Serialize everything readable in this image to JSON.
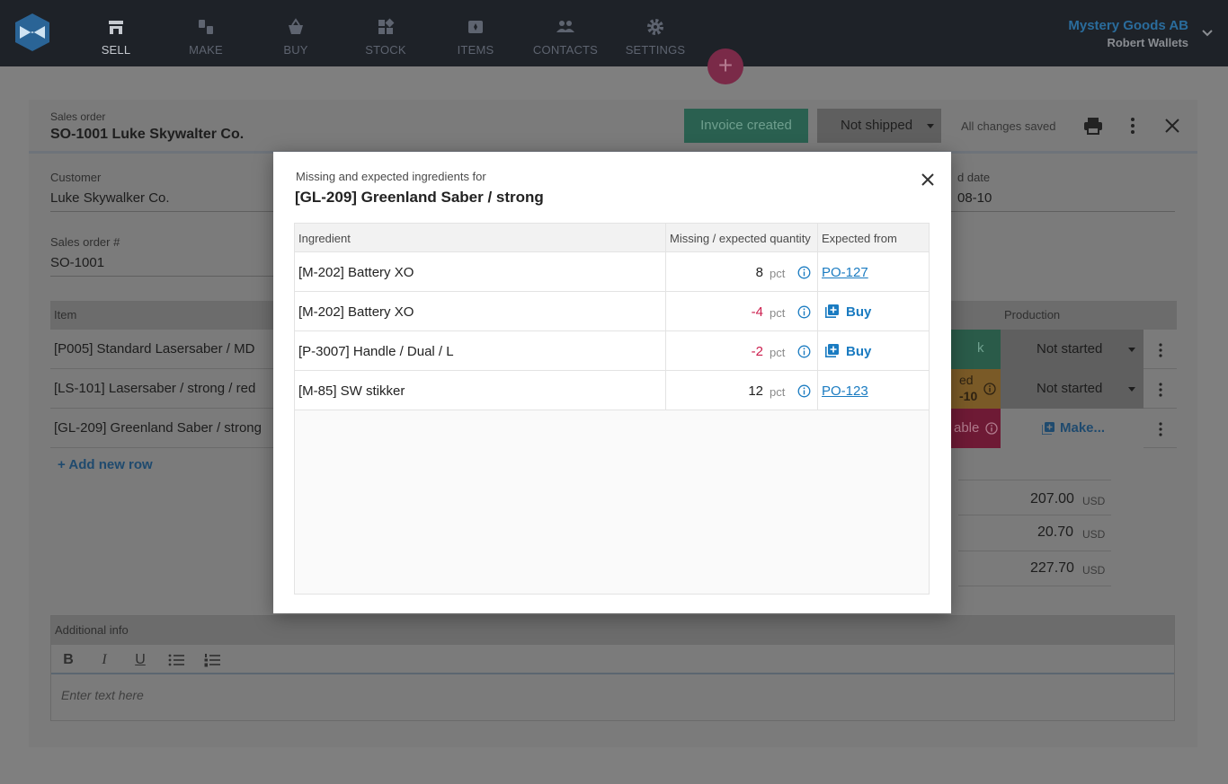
{
  "nav": {
    "items": [
      {
        "label": "SELL",
        "icon": "shop-icon",
        "active": true
      },
      {
        "label": "MAKE",
        "icon": "thumbs-icon"
      },
      {
        "label": "BUY",
        "icon": "basket-icon"
      },
      {
        "label": "STOCK",
        "icon": "stock-icon"
      },
      {
        "label": "ITEMS",
        "icon": "items-icon"
      },
      {
        "label": "CONTACTS",
        "icon": "contacts-icon"
      },
      {
        "label": "SETTINGS",
        "icon": "gear-icon"
      }
    ],
    "company": "Mystery Goods AB",
    "user": "Robert Wallets",
    "fab_label": "+"
  },
  "order": {
    "label": "Sales order",
    "title": "SO-1001  Luke Skywalter Co.",
    "invoice_status": "Invoice created",
    "shipping_status": "Not shipped",
    "save_status": "All changes saved",
    "customer_label": "Customer",
    "customer": "Luke Skywalker Co.",
    "order_no_label": "Sales order #",
    "order_no": "SO-1001",
    "delivery_label": "d date",
    "delivery_value": "08-10",
    "columns": {
      "item": "Item",
      "production": "Production"
    },
    "rows": [
      {
        "item": "[P005] Standard Lasersaber / MD",
        "status_text": "k",
        "production": "Not started"
      },
      {
        "item": "[LS-101] Lasersaber / strong / red",
        "status_text": "ed",
        "status_sub": "-10",
        "production": "Not started"
      },
      {
        "item": "[GL-209] Greenland Saber / strong",
        "status_text": "able",
        "production": "Make..."
      }
    ],
    "add_row": "+ Add new row",
    "totals": [
      {
        "value": "207.00",
        "currency": "USD"
      },
      {
        "value": "20.70",
        "currency": "USD"
      },
      {
        "value": "227.70",
        "currency": "USD"
      }
    ],
    "additional_info_label": "Additional info",
    "editor_placeholder": "Enter text here",
    "toolbar": {
      "bold": "B",
      "italic": "I",
      "underline": "U"
    }
  },
  "modal": {
    "subtitle": "Missing and expected ingredients for",
    "title": "[GL-209] Greenland Saber / strong",
    "columns": {
      "ingredient": "Ingredient",
      "quantity": "Missing / expected quantity",
      "expected_from": "Expected from"
    },
    "rows": [
      {
        "ingredient": "[M-202] Battery XO",
        "qty": "8",
        "unit": "pct",
        "expected": "PO-127",
        "type": "po"
      },
      {
        "ingredient": "[M-202] Battery XO",
        "qty": "-4",
        "unit": "pct",
        "expected": "Buy",
        "type": "buy"
      },
      {
        "ingredient": "[P-3007] Handle / Dual / L",
        "qty": "-2",
        "unit": "pct",
        "expected": "Buy",
        "type": "buy"
      },
      {
        "ingredient": "[M-85] SW stikker",
        "qty": "12",
        "unit": "pct",
        "expected": "PO-123",
        "type": "po"
      }
    ]
  },
  "colors": {
    "nav_bg": "#1e2228",
    "accent_link": "#1a7bc1",
    "negative": "#cc1d4d",
    "fab": "#7a2a48"
  }
}
